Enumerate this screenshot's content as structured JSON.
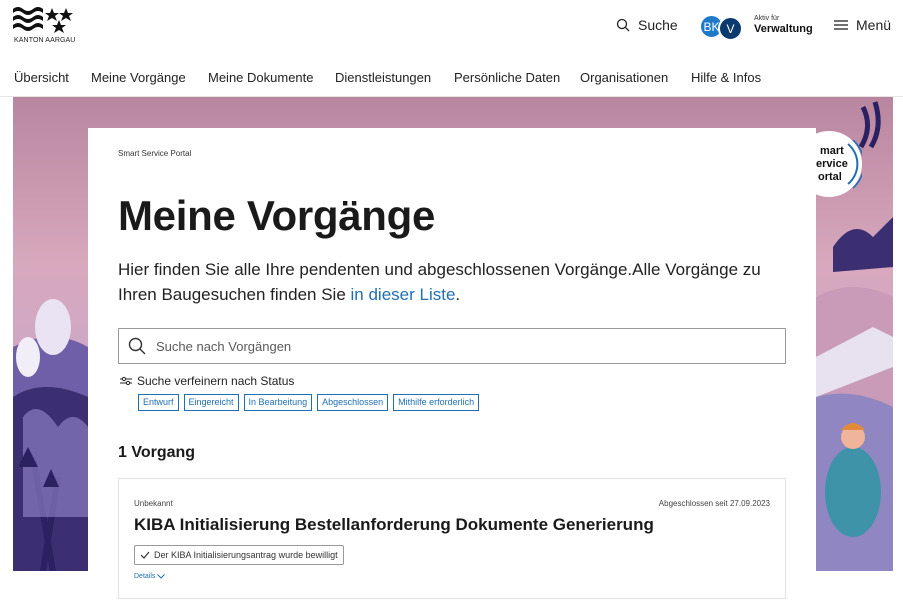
{
  "header": {
    "logo_text": "KANTON AARGAU",
    "search_label": "Suche",
    "avatar_primary": "BK",
    "avatar_secondary": "V",
    "role_caption": "Aktiv für",
    "role_name": "Verwaltung",
    "menu_label": "Menü"
  },
  "nav": {
    "items": [
      "Übersicht",
      "Meine Vorgänge",
      "Meine Dokumente",
      "Dienstleistungen",
      "Persönliche Daten",
      "Organisationen",
      "Hilfe & Infos"
    ]
  },
  "badge": {
    "lines": [
      "mart",
      "ervice",
      "ortal"
    ]
  },
  "main": {
    "breadcrumb": "Smart Service Portal",
    "title": "Meine Vorgänge",
    "intro_text": "Hier finden Sie alle Ihre pendenten und abgeschlossenen Vorgänge.Alle Vorgänge zu Ihren Baugesuchen finden Sie ",
    "intro_link": "in dieser Liste",
    "intro_end": ".",
    "search_placeholder": "Suche nach Vorgängen",
    "filter_label": "Suche verfeinern nach Status",
    "filters": [
      "Entwurf",
      "Eingereicht",
      "In Bearbeitung",
      "Abgeschlossen",
      "Mithilfe erforderlich"
    ],
    "count_label": "1 Vorgang",
    "item": {
      "status": "Unbekannt",
      "date": "Abgeschlossen seit 27.09.2023",
      "title": "KIBA Initialisierung Bestellanforderung Dokumente Generierung",
      "badge": "Der KIBA Initialisierungsantrag wurde bewilligt",
      "details": "Details"
    }
  },
  "colors": {
    "link": "#1f6fb5",
    "avatar_primary": "#1e7ac8",
    "avatar_secondary": "#0b3a6e"
  }
}
